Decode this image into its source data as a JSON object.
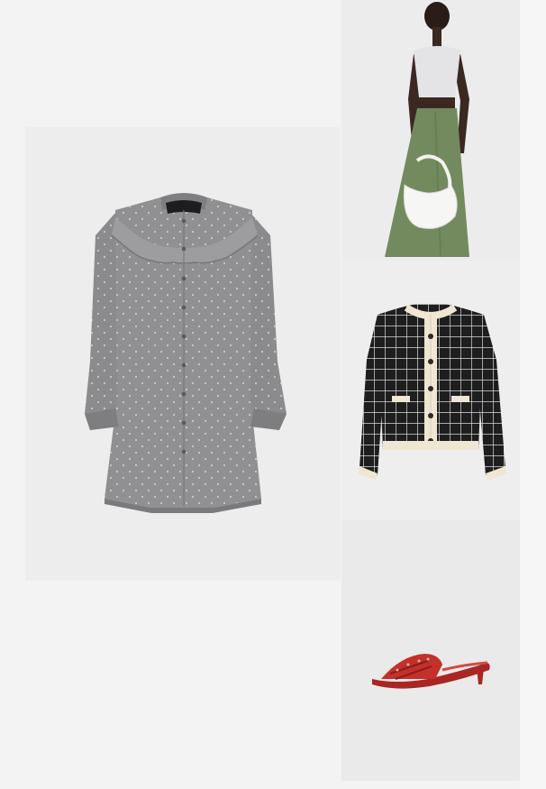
{
  "products": [
    {
      "id": "dress",
      "image": "grey-ruffle-shirt-dress-image"
    },
    {
      "id": "model",
      "image": "model-green-skirt-white-bag-image"
    },
    {
      "id": "cardigan",
      "image": "black-tweed-cardigan-image"
    },
    {
      "id": "sandal",
      "image": "red-kitten-heel-sandal-image"
    }
  ],
  "colors": {
    "page_bg": "#f3f3f3",
    "dress_grey": "#8d8d8f",
    "skirt_green": "#728a5e",
    "cardigan_black": "#1e1e1e",
    "cardigan_cream": "#efe6d4",
    "sandal_red": "#c4302b"
  }
}
